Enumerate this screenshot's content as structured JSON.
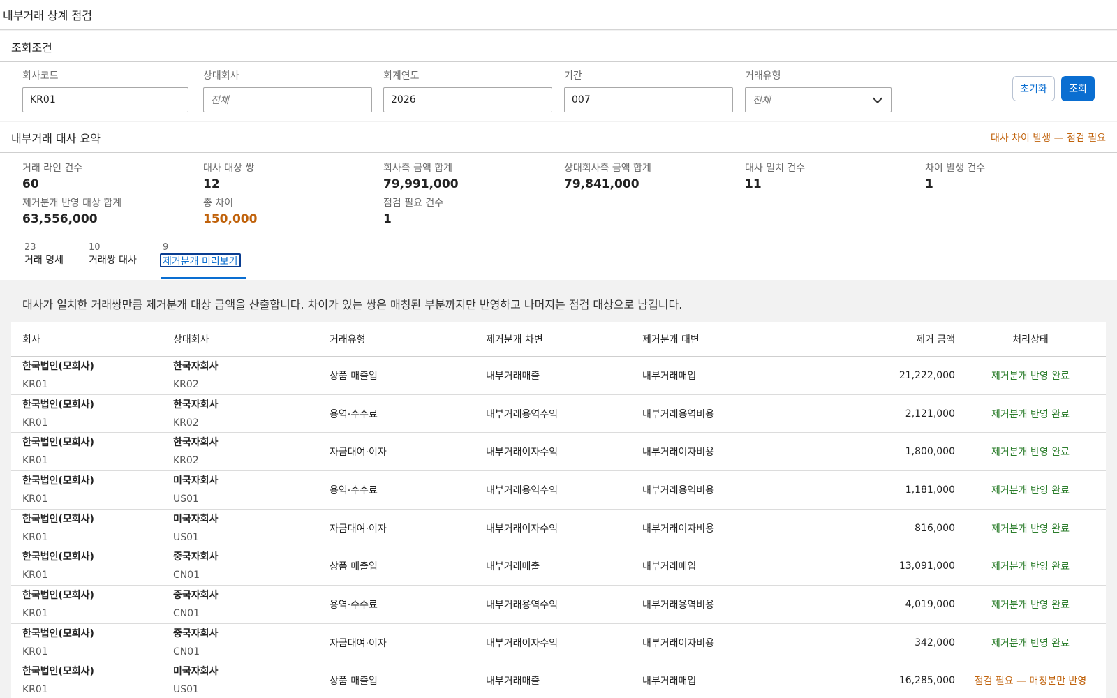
{
  "header": {
    "title": "내부거래 상계 점검"
  },
  "filters": {
    "title": "조회조건",
    "company_code": {
      "label": "회사코드",
      "value": "KR01"
    },
    "partner": {
      "label": "상대회사",
      "placeholder": "전체"
    },
    "fiscal_year": {
      "label": "회계연도",
      "value": "2026"
    },
    "period": {
      "label": "기간",
      "value": "007"
    },
    "txn_type": {
      "label": "거래유형",
      "placeholder": "전체"
    },
    "reset_label": "초기화",
    "search_label": "조회"
  },
  "summary": {
    "title": "내부거래 대사 요약",
    "alert": "대사 차이 발생 — 점검 필요",
    "kpis": [
      {
        "label": "거래 라인 건수",
        "value": "60"
      },
      {
        "label": "대사 대상 쌍",
        "value": "12"
      },
      {
        "label": "회사측 금액 합계",
        "value": "79,991,000"
      },
      {
        "label": "상대회사측 금액 합계",
        "value": "79,841,000"
      },
      {
        "label": "대사 일치 건수",
        "value": "11"
      },
      {
        "label": "차이 발생 건수",
        "value": "1"
      },
      {
        "label": "제거분개 반영 대상 합계",
        "value": "63,556,000"
      },
      {
        "label": "총 차이",
        "value": "150,000"
      },
      {
        "label": "점검 필요 건수",
        "value": "1"
      }
    ]
  },
  "tabs": [
    {
      "count": "23",
      "label": "거래 명세"
    },
    {
      "count": "10",
      "label": "거래쌍 대사"
    },
    {
      "count": "9",
      "label": "제거분개 미리보기"
    }
  ],
  "preview": {
    "description": "대사가 일치한 거래쌍만큼 제거분개 대상 금액을 산출합니다. 차이가 있는 쌍은 매칭된 부분까지만 반영하고 나머지는 점검 대상으로 남깁니다.",
    "columns": [
      "회사",
      "상대회사",
      "거래유형",
      "제거분개 차변",
      "제거분개 대변",
      "제거 금액",
      "처리상태"
    ],
    "rows": [
      {
        "company": "한국법인(모회사)",
        "company_code": "KR01",
        "partner": "한국자회사",
        "partner_code": "KR02",
        "type": "상품 매출입",
        "debit": "내부거래매출",
        "credit": "내부거래매입",
        "amount": "21,222,000",
        "status": "제거분개 반영 완료"
      },
      {
        "company": "한국법인(모회사)",
        "company_code": "KR01",
        "partner": "한국자회사",
        "partner_code": "KR02",
        "type": "용역·수수료",
        "debit": "내부거래용역수익",
        "credit": "내부거래용역비용",
        "amount": "2,121,000",
        "status": "제거분개 반영 완료"
      },
      {
        "company": "한국법인(모회사)",
        "company_code": "KR01",
        "partner": "한국자회사",
        "partner_code": "KR02",
        "type": "자금대여·이자",
        "debit": "내부거래이자수익",
        "credit": "내부거래이자비용",
        "amount": "1,800,000",
        "status": "제거분개 반영 완료"
      },
      {
        "company": "한국법인(모회사)",
        "company_code": "KR01",
        "partner": "미국자회사",
        "partner_code": "US01",
        "type": "용역·수수료",
        "debit": "내부거래용역수익",
        "credit": "내부거래용역비용",
        "amount": "1,181,000",
        "status": "제거분개 반영 완료"
      },
      {
        "company": "한국법인(모회사)",
        "company_code": "KR01",
        "partner": "미국자회사",
        "partner_code": "US01",
        "type": "자금대여·이자",
        "debit": "내부거래이자수익",
        "credit": "내부거래이자비용",
        "amount": "816,000",
        "status": "제거분개 반영 완료"
      },
      {
        "company": "한국법인(모회사)",
        "company_code": "KR01",
        "partner": "중국자회사",
        "partner_code": "CN01",
        "type": "상품 매출입",
        "debit": "내부거래매출",
        "credit": "내부거래매입",
        "amount": "13,091,000",
        "status": "제거분개 반영 완료"
      },
      {
        "company": "한국법인(모회사)",
        "company_code": "KR01",
        "partner": "중국자회사",
        "partner_code": "CN01",
        "type": "용역·수수료",
        "debit": "내부거래용역수익",
        "credit": "내부거래용역비용",
        "amount": "4,019,000",
        "status": "제거분개 반영 완료"
      },
      {
        "company": "한국법인(모회사)",
        "company_code": "KR01",
        "partner": "중국자회사",
        "partner_code": "CN01",
        "type": "자금대여·이자",
        "debit": "내부거래이자수익",
        "credit": "내부거래이자비용",
        "amount": "342,000",
        "status": "제거분개 반영 완료"
      },
      {
        "company": "한국법인(모회사)",
        "company_code": "KR01",
        "partner": "미국자회사",
        "partner_code": "US01",
        "type": "상품 매출입",
        "debit": "내부거래매출",
        "credit": "내부거래매입",
        "amount": "16,285,000",
        "status": "점검 필요 — 매칭분만 반영"
      }
    ]
  },
  "colors": {
    "accent": "#0a6ed1",
    "ok": "#2b7d2b",
    "warn": "#c0620b"
  }
}
